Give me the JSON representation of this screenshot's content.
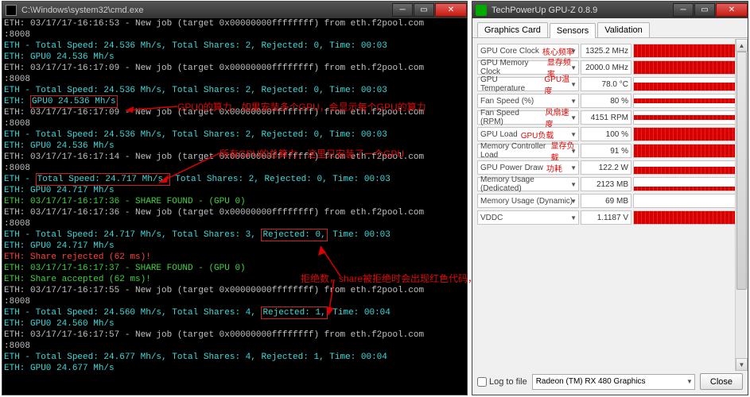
{
  "console": {
    "title": "C:\\Windows\\system32\\cmd.exe",
    "lines": [
      {
        "c": "w",
        "t": "ETH: 03/17/17-16:16:53 - New job (target 0x00000000ffffffff) from eth.f2pool.com:8008"
      },
      {
        "c": "c",
        "t": "ETH - Total Speed: 24.536 Mh/s, Total Shares: 2, Rejected: 0, Time: 00:03"
      },
      {
        "c": "c",
        "t": "ETH: GPU0 24.536 Mh/s"
      },
      {
        "c": "w",
        "t": "ETH: 03/17/17-16:17:09 - New job (target 0x00000000ffffffff) from eth.f2pool.com:8008"
      },
      {
        "c": "c",
        "t": "ETH - Total Speed: 24.536 Mh/s, Total Shares: 2, Rejected: 0, Time: 00:03"
      },
      {
        "c": "c",
        "t": "ETH: ",
        "box": "GPU0 24.536 Mh/s"
      },
      {
        "c": "w",
        "t": "ETH: 03/17/17-16:17:09 - New job (target 0x00000000ffffffff) from eth.f2pool.com:8008"
      },
      {
        "c": "c",
        "t": "ETH - Total Speed: 24.536 Mh/s, Total Shares: 2, Rejected: 0, Time: 00:03"
      },
      {
        "c": "c",
        "t": "ETH: GPU0 24.536 Mh/s"
      },
      {
        "c": "w",
        "t": "ETH: 03/17/17-16:17:14 - New job (target 0x00000000ffffffff) from eth.f2pool.com:8008"
      },
      {
        "c": "c",
        "t": "ETH - ",
        "box": "Total Speed: 24.717 Mh/s,",
        "t2": " Total Shares: 2, Rejected: 0, Time: 00:03"
      },
      {
        "c": "c",
        "t": "ETH: GPU0 24.717 Mh/s"
      },
      {
        "c": "g",
        "t": "ETH: 03/17/17-16:17:36 - SHARE FOUND - (GPU 0)"
      },
      {
        "c": "w",
        "t": "ETH: 03/17/17-16:17:36 - New job (target 0x00000000ffffffff) from eth.f2pool.com:8008"
      },
      {
        "c": "c",
        "t": "ETH - Total Speed: 24.717 Mh/s, Total Shares: 3, ",
        "box": "Rejected: 0,",
        "t2": " Time: 00:03"
      },
      {
        "c": "c",
        "t": "ETH: GPU0 24.717 Mh/s"
      },
      {
        "c": "r",
        "t": "ETH: Share rejected (62 ms)!"
      },
      {
        "c": "g",
        "t": "ETH: 03/17/17-16:17:37 - SHARE FOUND - (GPU 0)"
      },
      {
        "c": "g",
        "t": "ETH: Share accepted (62 ms)!"
      },
      {
        "c": "w",
        "t": "ETH: 03/17/17-16:17:55 - New job (target 0x00000000ffffffff) from eth.f2pool.com:8008"
      },
      {
        "c": "c",
        "t": "ETH - Total Speed: 24.560 Mh/s, Total Shares: 4, ",
        "box": "Rejected: 1,",
        "t2": " Time: 00:04"
      },
      {
        "c": "c",
        "t": "ETH: GPU0 24.560 Mh/s"
      },
      {
        "c": "w",
        "t": "ETH: 03/17/17-16:17:57 - New job (target 0x00000000ffffffff) from eth.f2pool.com:8008"
      },
      {
        "c": "c",
        "t": "ETH - Total Speed: 24.677 Mh/s, Total Shares: 4, Rejected: 1, Time: 00:04"
      },
      {
        "c": "c",
        "t": "ETH: GPU0 24.677 Mh/s"
      }
    ]
  },
  "annotations": {
    "a1": "GPU0的算力，如果安装多个GPU，会显示每个GPU的算力",
    "a2": "所有GPU的总算力，这里只安装了一个GPU",
    "a3": "拒绝数，share被拒绝时会出现红色代码，R值会增加"
  },
  "gpuz": {
    "title": "TechPowerUp GPU-Z 0.8.9",
    "tabs": {
      "t1": "Graphics Card",
      "t2": "Sensors",
      "t3": "Validation"
    },
    "sensors": [
      {
        "name": "GPU Core Clock",
        "anno": "核心频率",
        "val": "1325.2 MHz",
        "g": "red"
      },
      {
        "name": "GPU Memory Clock",
        "anno": "显存频率",
        "val": "2000.0 MHz",
        "g": "red"
      },
      {
        "name": "GPU Temperature",
        "anno": "GPU温度",
        "val": "78.0 °C",
        "g": "redhalf"
      },
      {
        "name": "Fan Speed (%)",
        "anno": "",
        "val": "80 %",
        "g": "redband"
      },
      {
        "name": "Fan Speed (RPM)",
        "anno": "风扇速度",
        "val": "4151 RPM",
        "g": "redband"
      },
      {
        "name": "GPU Load",
        "anno": "GPU负载",
        "val": "100 %",
        "g": "red"
      },
      {
        "name": "Memory Controller Load",
        "anno": "显存负载",
        "val": "91 %",
        "g": "red"
      },
      {
        "name": "GPU Power Draw",
        "anno": "功耗",
        "val": "122.2 W",
        "g": "redmid"
      },
      {
        "name": "Memory Usage (Dedicated)",
        "anno": "",
        "val": "2123 MB",
        "g": "redlow"
      },
      {
        "name": "Memory Usage (Dynamic)",
        "anno": "",
        "val": "69 MB",
        "g": "none"
      },
      {
        "name": "VDDC",
        "anno": "",
        "val": "1.1187 V",
        "g": "red"
      }
    ],
    "log_label": "Log to file",
    "device": "Radeon (TM) RX 480 Graphics",
    "close_btn": "Close"
  }
}
